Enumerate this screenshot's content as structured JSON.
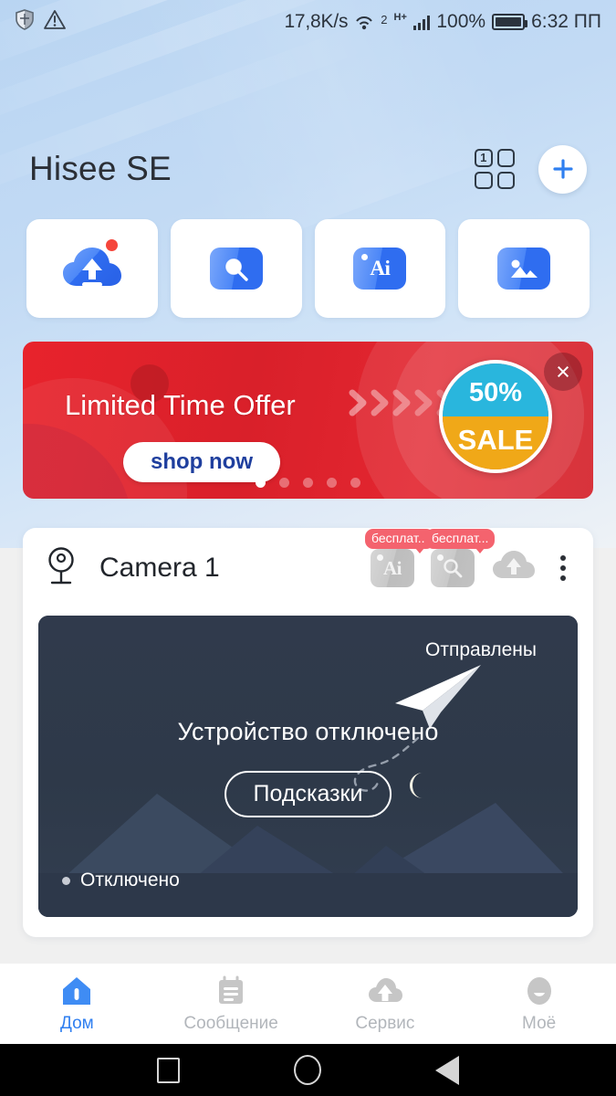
{
  "status_bar": {
    "left_icons": [
      "shield-icon",
      "warning-triangle-icon"
    ],
    "network_speed": "17,8K/s",
    "wifi_label": "2",
    "data_type": "H+",
    "battery_percent": "100%",
    "time": "6:32 ПП"
  },
  "header": {
    "title": "Hisee SE",
    "grid_badge": "1",
    "add_label": "+"
  },
  "quick_actions": [
    {
      "name": "cloud-upload",
      "label": "",
      "has_badge": true
    },
    {
      "name": "search-photo",
      "label": "",
      "has_badge": false
    },
    {
      "name": "ai",
      "label": "Ai",
      "has_badge": false
    },
    {
      "name": "gallery",
      "label": "",
      "has_badge": false
    }
  ],
  "banner": {
    "title": "Limited Time Offer",
    "cta": "shop now",
    "sale_percent": "50%",
    "sale_word": "SALE",
    "close_label": "×",
    "dots_total": 5,
    "dots_active": 1,
    "bg_color": "#de2028",
    "sale_top_color": "#29b6dd",
    "sale_bottom_color": "#f0a818"
  },
  "camera_card": {
    "name": "Camera 1",
    "tools": [
      {
        "name": "ai-tool",
        "label": "Ai",
        "badge": "бесплат..."
      },
      {
        "name": "search-tool",
        "label": "",
        "badge": "бесплат..."
      },
      {
        "name": "cloud-upload-tool",
        "label": "",
        "badge": ""
      }
    ],
    "menu_label": "⋮",
    "preview": {
      "sent_label": "Отправлены",
      "offline_title": "Устройство отключено",
      "hint_button": "Подсказки",
      "status": "Отключено",
      "bg_color": "#2f3a4d"
    }
  },
  "bottom_nav": {
    "items": [
      {
        "label": "Дом",
        "icon": "home-icon",
        "active": true
      },
      {
        "label": "Сообщение",
        "icon": "message-icon",
        "active": false
      },
      {
        "label": "Сервис",
        "icon": "service-cloud-icon",
        "active": false
      },
      {
        "label": "Моё",
        "icon": "profile-icon",
        "active": false
      }
    ],
    "active_color": "#2f7ff0",
    "inactive_color": "#b2b6bb"
  },
  "android_nav": {
    "recents": "square",
    "home": "circle",
    "back": "triangle"
  }
}
